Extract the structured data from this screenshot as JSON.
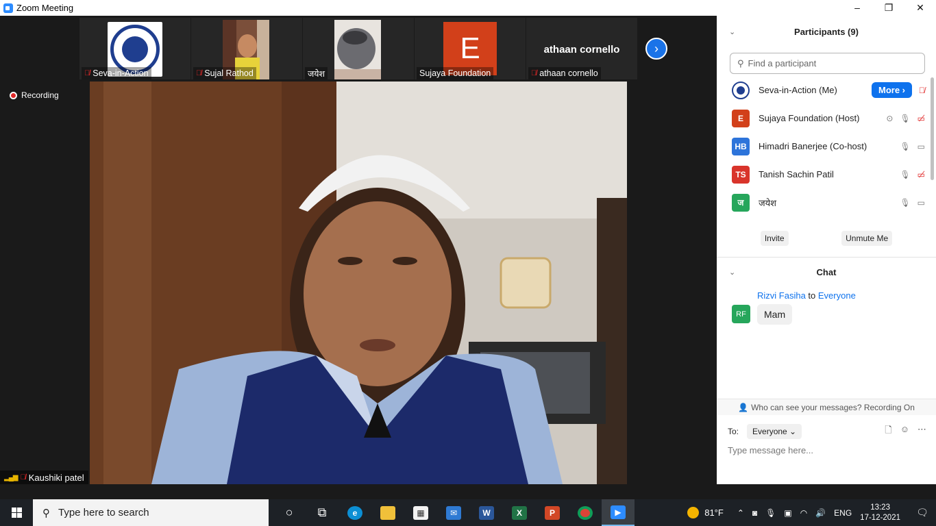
{
  "window": {
    "title": "Zoom Meeting",
    "controls": [
      "–",
      "❐",
      "✕"
    ]
  },
  "thumbnails": [
    {
      "name": "Seva-in-Action",
      "muted": true,
      "kind": "logo"
    },
    {
      "name": "Sujal Rathod",
      "muted": true,
      "kind": "video"
    },
    {
      "name": "जयेश",
      "muted": false,
      "kind": "video"
    },
    {
      "name": "Sujaya Foundation",
      "muted": false,
      "kind": "avatar",
      "initial": "E"
    },
    {
      "name": "athaan cornello",
      "muted": true,
      "kind": "name",
      "display": "athaan cornello"
    }
  ],
  "next_icon": "›",
  "recording": {
    "label": "Recording"
  },
  "active_speaker": {
    "name": "Kaushiki patel",
    "muted": true
  },
  "participants": {
    "title": "Participants (9)",
    "search_placeholder": "Find a participant",
    "list": [
      {
        "name": "Seva-in-Action (Me)",
        "avatar": "",
        "color": "#ffffff",
        "more": "More ›"
      },
      {
        "name": "Sujaya Foundation (Host)",
        "avatar": "E",
        "color": "#d2401a"
      },
      {
        "name": "Himadri Banerjee (Co-host)",
        "avatar": "HB",
        "color": "#2d74da"
      },
      {
        "name": "Tanish Sachin Patil",
        "avatar": "TS",
        "color": "#d9342b"
      },
      {
        "name": "जयेश",
        "avatar": "ज",
        "color": "#26a65b"
      }
    ],
    "invite": "Invite",
    "unmute": "Unmute Me"
  },
  "chat": {
    "title": "Chat",
    "message": {
      "from": "Rizvi Fasiha",
      "to_word": "to",
      "to": "Everyone",
      "avatar": "RF",
      "text": "Mam"
    },
    "privacy": "Who can see your messages? Recording On",
    "to_label": "To:",
    "to_value": "Everyone ⌄",
    "placeholder": "Type message here..."
  },
  "taskbar": {
    "search_placeholder": "Type here to search",
    "weather": "81°F",
    "language": "ENG",
    "time": "13:23",
    "date": "17-12-2021"
  }
}
